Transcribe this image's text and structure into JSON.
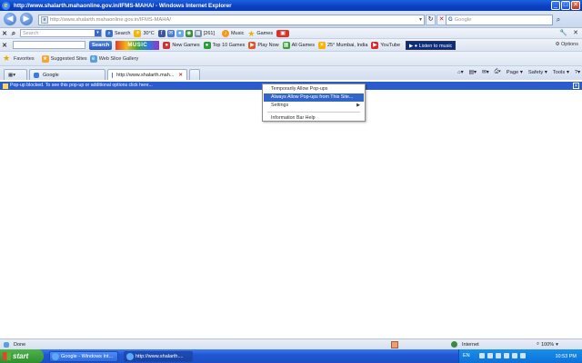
{
  "window": {
    "title": "http://www.shalarth.mahaonline.gov.in/IFMS-MAHA/ - Windows Internet Explorer",
    "min_label": "_",
    "max_label": "□",
    "close_label": "✕"
  },
  "address_bar": {
    "url": "http://www.shalarth.mahaonline.gov.in/IFMS-MAHA/",
    "search_placeholder": "Google",
    "search_engine_label": "G"
  },
  "toolbar1": {
    "search_placeholder": "Search",
    "search_label": "Search",
    "temperature": "30°C",
    "count": "[261]",
    "music_label": "Music",
    "games_label": "Games"
  },
  "toolbar2": {
    "search_button": "Search",
    "logo_text": "MUSIC",
    "new_games": "New Games",
    "top_games": "Top 10 Games",
    "play_now": "Play Now",
    "all_games": "All Games",
    "weather": "25° Mumbai, India",
    "youtube": "YouTube",
    "listen": "Listen to music",
    "options": "Options"
  },
  "favorites_bar": {
    "favorites": "Favorites",
    "suggested": "Suggested Sites",
    "slice": "Web Slice Gallery"
  },
  "tabs": [
    {
      "label": "Google"
    },
    {
      "label": "http://www.shalarth.mah..."
    }
  ],
  "command_bar": {
    "page": "Page",
    "safety": "Safety",
    "tools": "Tools"
  },
  "infobar": {
    "text": "Pop-up blocked. To see this pop-up or additional options click here..."
  },
  "context_menu": {
    "items": [
      {
        "label": "Temporarily Allow Pop-ups"
      },
      {
        "label": "Always Allow Pop-ups from This Site..."
      },
      {
        "label": "Settings"
      },
      {
        "label": "Information Bar Help"
      }
    ]
  },
  "status_bar": {
    "status": "Done",
    "zone": "Internet",
    "zoom": "100%"
  },
  "taskbar": {
    "start": "start",
    "buttons": [
      {
        "label": "Google - Windows Int..."
      },
      {
        "label": "http://www.shalarth...."
      }
    ],
    "language": "EN",
    "clock": "10:53 PM"
  },
  "colors": {
    "title_bar": "#0a3fc0",
    "infobar": "#2a5ccf",
    "menu_highlight": "#3166c8",
    "taskbar": "#1f57d2",
    "start_button": "#2e8f2e"
  }
}
